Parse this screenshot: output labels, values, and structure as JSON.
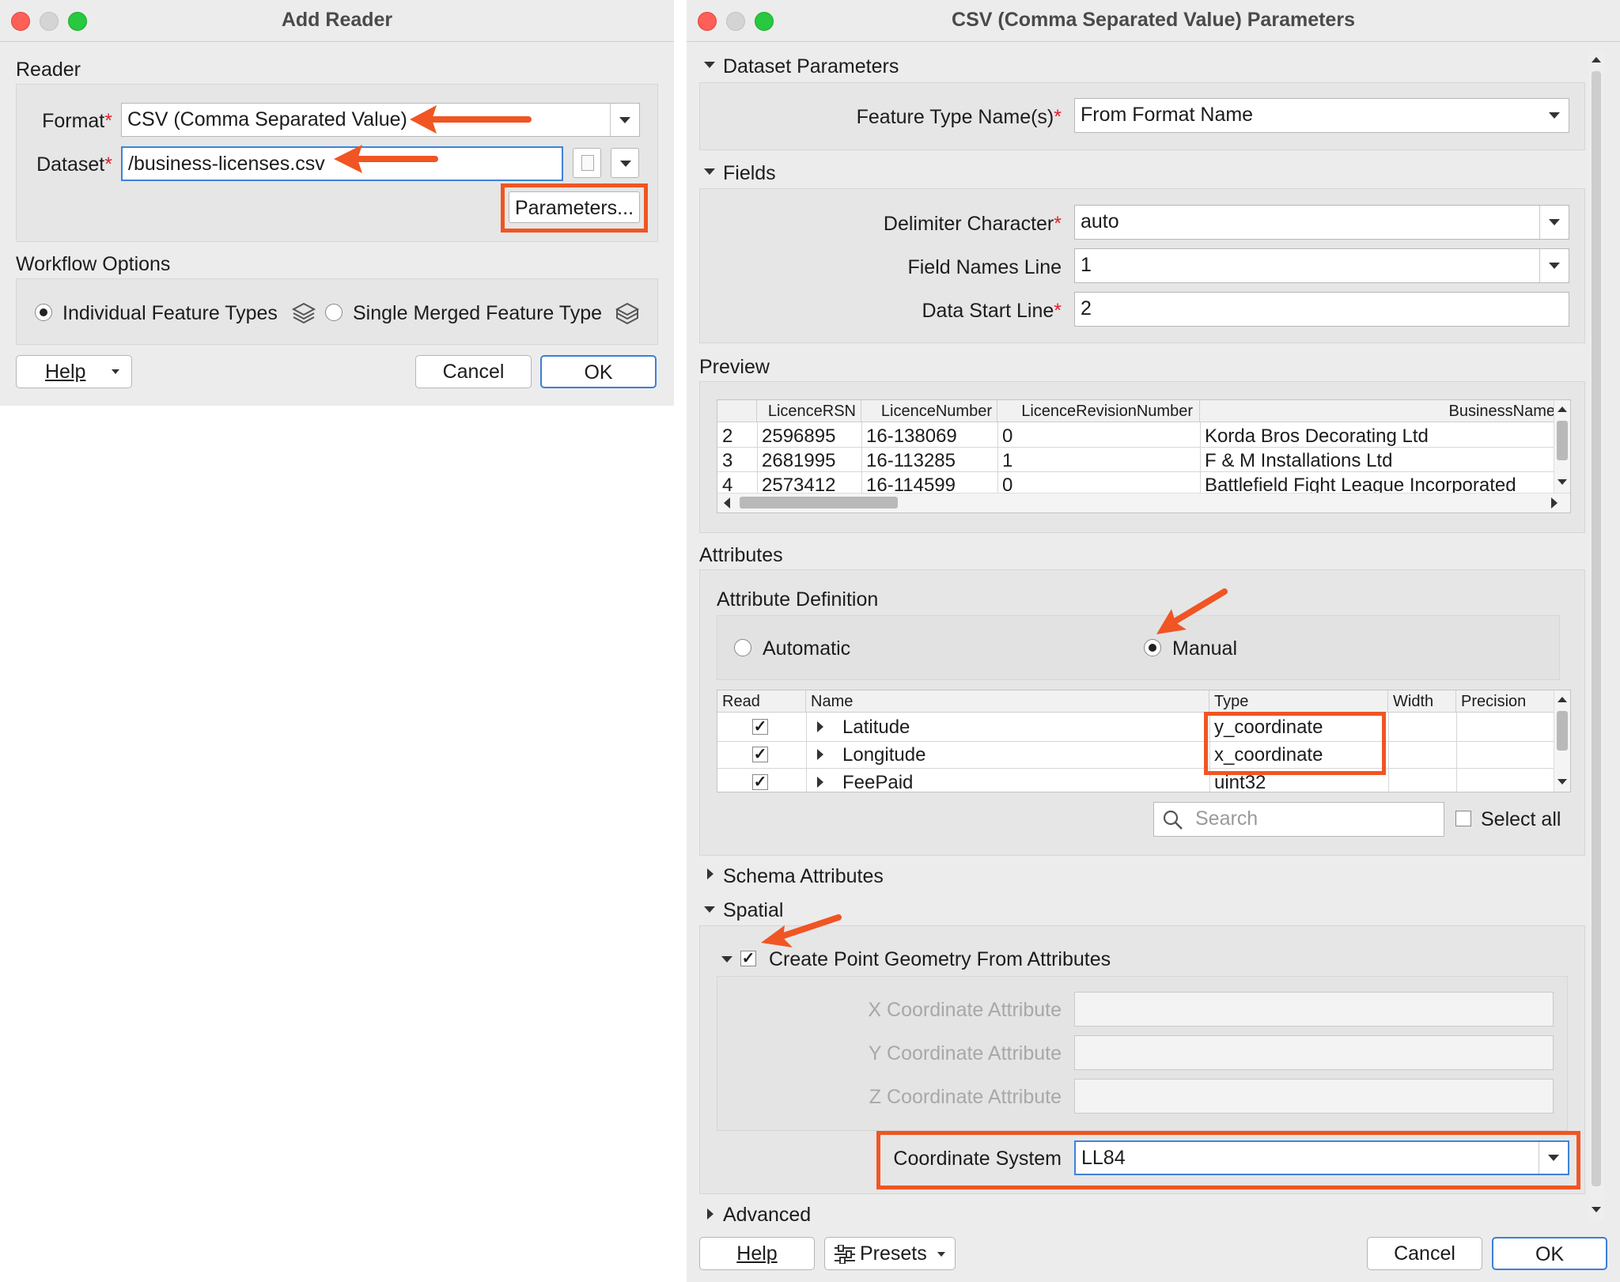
{
  "left_dialog": {
    "title": "Add Reader",
    "reader_section": "Reader",
    "format_label": "Format",
    "format_value": "CSV (Comma Separated Value)",
    "dataset_label": "Dataset",
    "dataset_value": "/business-licenses.csv",
    "parameters_button": "Parameters...",
    "workflow_section": "Workflow Options",
    "option_individual": "Individual Feature Types",
    "option_merged": "Single Merged Feature Type",
    "help_button": "Help",
    "cancel_button": "Cancel",
    "ok_button": "OK"
  },
  "right_dialog": {
    "title": "CSV (Comma Separated Value) Parameters",
    "dataset_params_section": "Dataset Parameters",
    "feature_type_label": "Feature Type Name(s)",
    "feature_type_value": "From Format Name",
    "fields_section": "Fields",
    "delimiter_label": "Delimiter Character",
    "delimiter_value": "auto",
    "field_names_label": "Field Names Line",
    "field_names_value": "1",
    "data_start_label": "Data Start Line",
    "data_start_value": "2",
    "preview_section": "Preview",
    "preview": {
      "columns": [
        "LicenceRSN",
        "LicenceNumber",
        "LicenceRevisionNumber",
        "BusinessName"
      ],
      "rows": [
        {
          "n": "2",
          "rsn": "2596895",
          "num": "16-138069",
          "rev": "0",
          "name": "Korda Bros Decorating Ltd"
        },
        {
          "n": "3",
          "rsn": "2681995",
          "num": "16-113285",
          "rev": "1",
          "name": "F & M Installations Ltd"
        },
        {
          "n": "4",
          "rsn": "2573412",
          "num": "16-114599",
          "rev": "0",
          "name": "Battlefield Fight League Incorporated"
        }
      ]
    },
    "attributes_section": "Attributes",
    "attr_def_label": "Attribute Definition",
    "attr_automatic": "Automatic",
    "attr_manual": "Manual",
    "attr_table": {
      "columns": [
        "Read",
        "Name",
        "Type",
        "Width",
        "Precision"
      ],
      "rows": [
        {
          "name": "Latitude",
          "type": "y_coordinate"
        },
        {
          "name": "Longitude",
          "type": "x_coordinate"
        },
        {
          "name": "FeePaid",
          "type": "uint32"
        }
      ]
    },
    "search_placeholder": "Search",
    "select_all": "Select all",
    "schema_section": "Schema Attributes",
    "spatial_section": "Spatial",
    "create_point_label": "Create Point Geometry From Attributes",
    "x_coord_label": "X Coordinate Attribute",
    "y_coord_label": "Y Coordinate Attribute",
    "z_coord_label": "Z Coordinate Attribute",
    "coord_system_label": "Coordinate System",
    "coord_system_value": "LL84",
    "advanced_section": "Advanced",
    "help_button": "Help",
    "presets_button": "Presets",
    "cancel_button": "Cancel",
    "ok_button": "OK"
  },
  "colors": {
    "annotation": "#f05523",
    "focus": "#3f82d8",
    "required": "#e0202f"
  }
}
